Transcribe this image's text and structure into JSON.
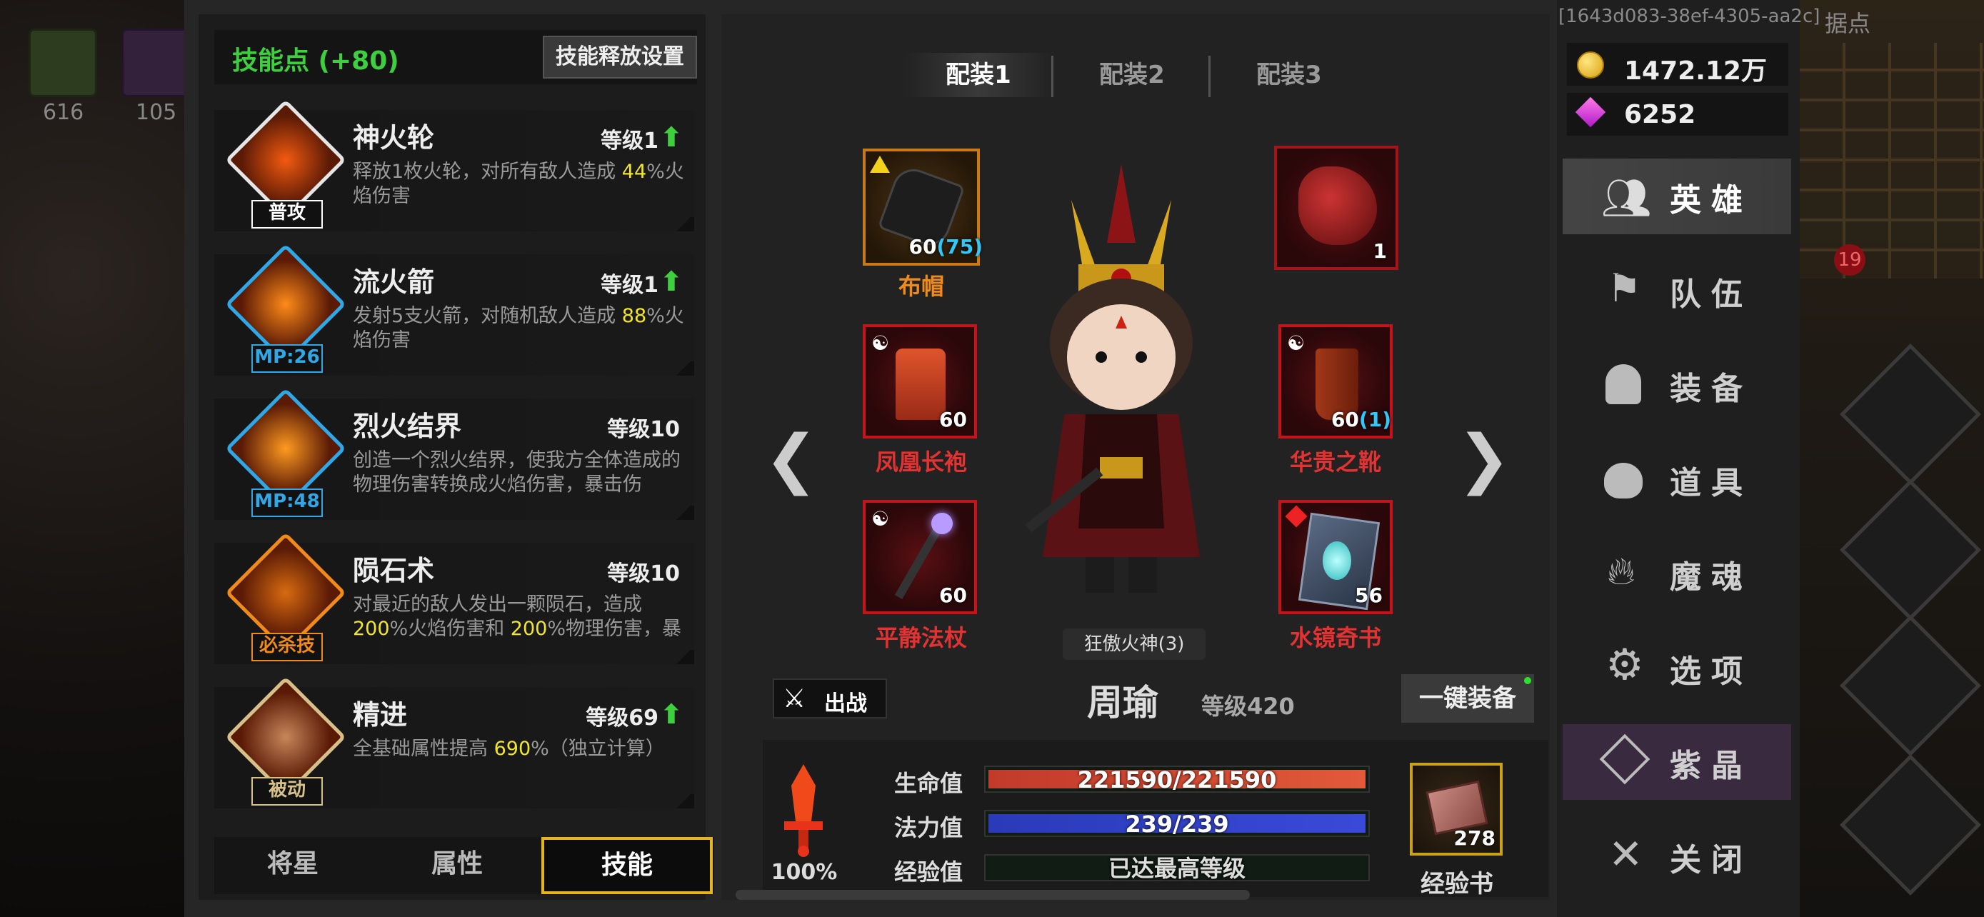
{
  "uuid_label": "[1643d083-38ef-4305-aa2c]",
  "world": {
    "outpost_label": "据点",
    "slot1_count": "616",
    "slot2_count": "105",
    "enemy_level": "19"
  },
  "currency": {
    "gold": "1472.12万",
    "gems": "6252"
  },
  "skills_header": {
    "points_label": "技能点 (+80)",
    "release_settings": "技能释放设置"
  },
  "skills": [
    {
      "name": "神火轮",
      "level": "等级1",
      "upgradable": true,
      "tag": "普攻",
      "desc_pre": "释放1枚火轮，对所有敌人造成 ",
      "hl1": "44",
      "desc_mid": "%火焰伤害",
      "hl2": "",
      "desc_post": ""
    },
    {
      "name": "流火箭",
      "level": "等级1",
      "upgradable": true,
      "tag": "MP:26",
      "desc_pre": "发射5支火箭，对随机敌人造成 ",
      "hl1": "88",
      "desc_mid": "%火焰伤害",
      "hl2": "",
      "desc_post": ""
    },
    {
      "name": "烈火结界",
      "level": "等级10",
      "upgradable": false,
      "tag": "MP:48",
      "desc_pre": "创造一个烈火结界，使我方全体造成的物理伤害转换成火焰伤害，暴击伤",
      "hl1": "",
      "desc_mid": "",
      "hl2": "",
      "desc_post": ""
    },
    {
      "name": "陨石术",
      "level": "等级10",
      "upgradable": false,
      "tag": "必杀技",
      "desc_pre": "对最近的敌人发出一颗陨石，造成 ",
      "hl1": "200",
      "desc_mid": "%火焰伤害和 ",
      "hl2": "200",
      "desc_post": "%物理伤害，暴"
    },
    {
      "name": "精进",
      "level": "等级69",
      "upgradable": true,
      "tag": "被动",
      "desc_pre": "全基础属性提高 ",
      "hl1": "690",
      "desc_mid": "%（独立计算）",
      "hl2": "",
      "desc_post": ""
    }
  ],
  "bottom_tabs": [
    "将星",
    "属性",
    "技能"
  ],
  "active_bottom_tab": 2,
  "loadout_tabs": [
    "配装1",
    "配装2",
    "配装3"
  ],
  "active_loadout": 0,
  "equipment": {
    "hat": {
      "name": "布帽",
      "level": "60",
      "bonus": "(75)"
    },
    "pet": {
      "level": "1"
    },
    "robe": {
      "name": "凤凰长袍",
      "level": "60"
    },
    "boots": {
      "name": "华贵之靴",
      "level": "60",
      "bonus": "(1)"
    },
    "staff": {
      "name": "平静法杖",
      "level": "60"
    },
    "book": {
      "name": "水镜奇书",
      "level": "56"
    }
  },
  "hero": {
    "title": "狂傲火神(3)",
    "name": "周瑜",
    "level": "等级420",
    "deploy_label": "出战",
    "equip_all_label": "一键装备",
    "power_percent": "100%"
  },
  "stats": {
    "hp": {
      "label": "生命值",
      "text": "221590/221590",
      "fill": 1.0
    },
    "mp": {
      "label": "法力值",
      "text": "239/239",
      "fill": 1.0
    },
    "exp": {
      "label": "经验值",
      "text": "已达最高等级",
      "fill": 0
    }
  },
  "exp_book": {
    "label": "经验书",
    "count": "278"
  },
  "menu": [
    "英雄",
    "队伍",
    "装备",
    "道具",
    "魔魂",
    "选项",
    "紫晶",
    "关闭"
  ],
  "active_menu": 0,
  "colors": {
    "accent_green": "#3ecf3e",
    "highlight_yellow": "#f2e62a",
    "equip_red": "#e23232",
    "equip_orange": "#f08a18",
    "mp_blue": "#2fa8e8",
    "crystal_purple": "#3a2a40"
  }
}
